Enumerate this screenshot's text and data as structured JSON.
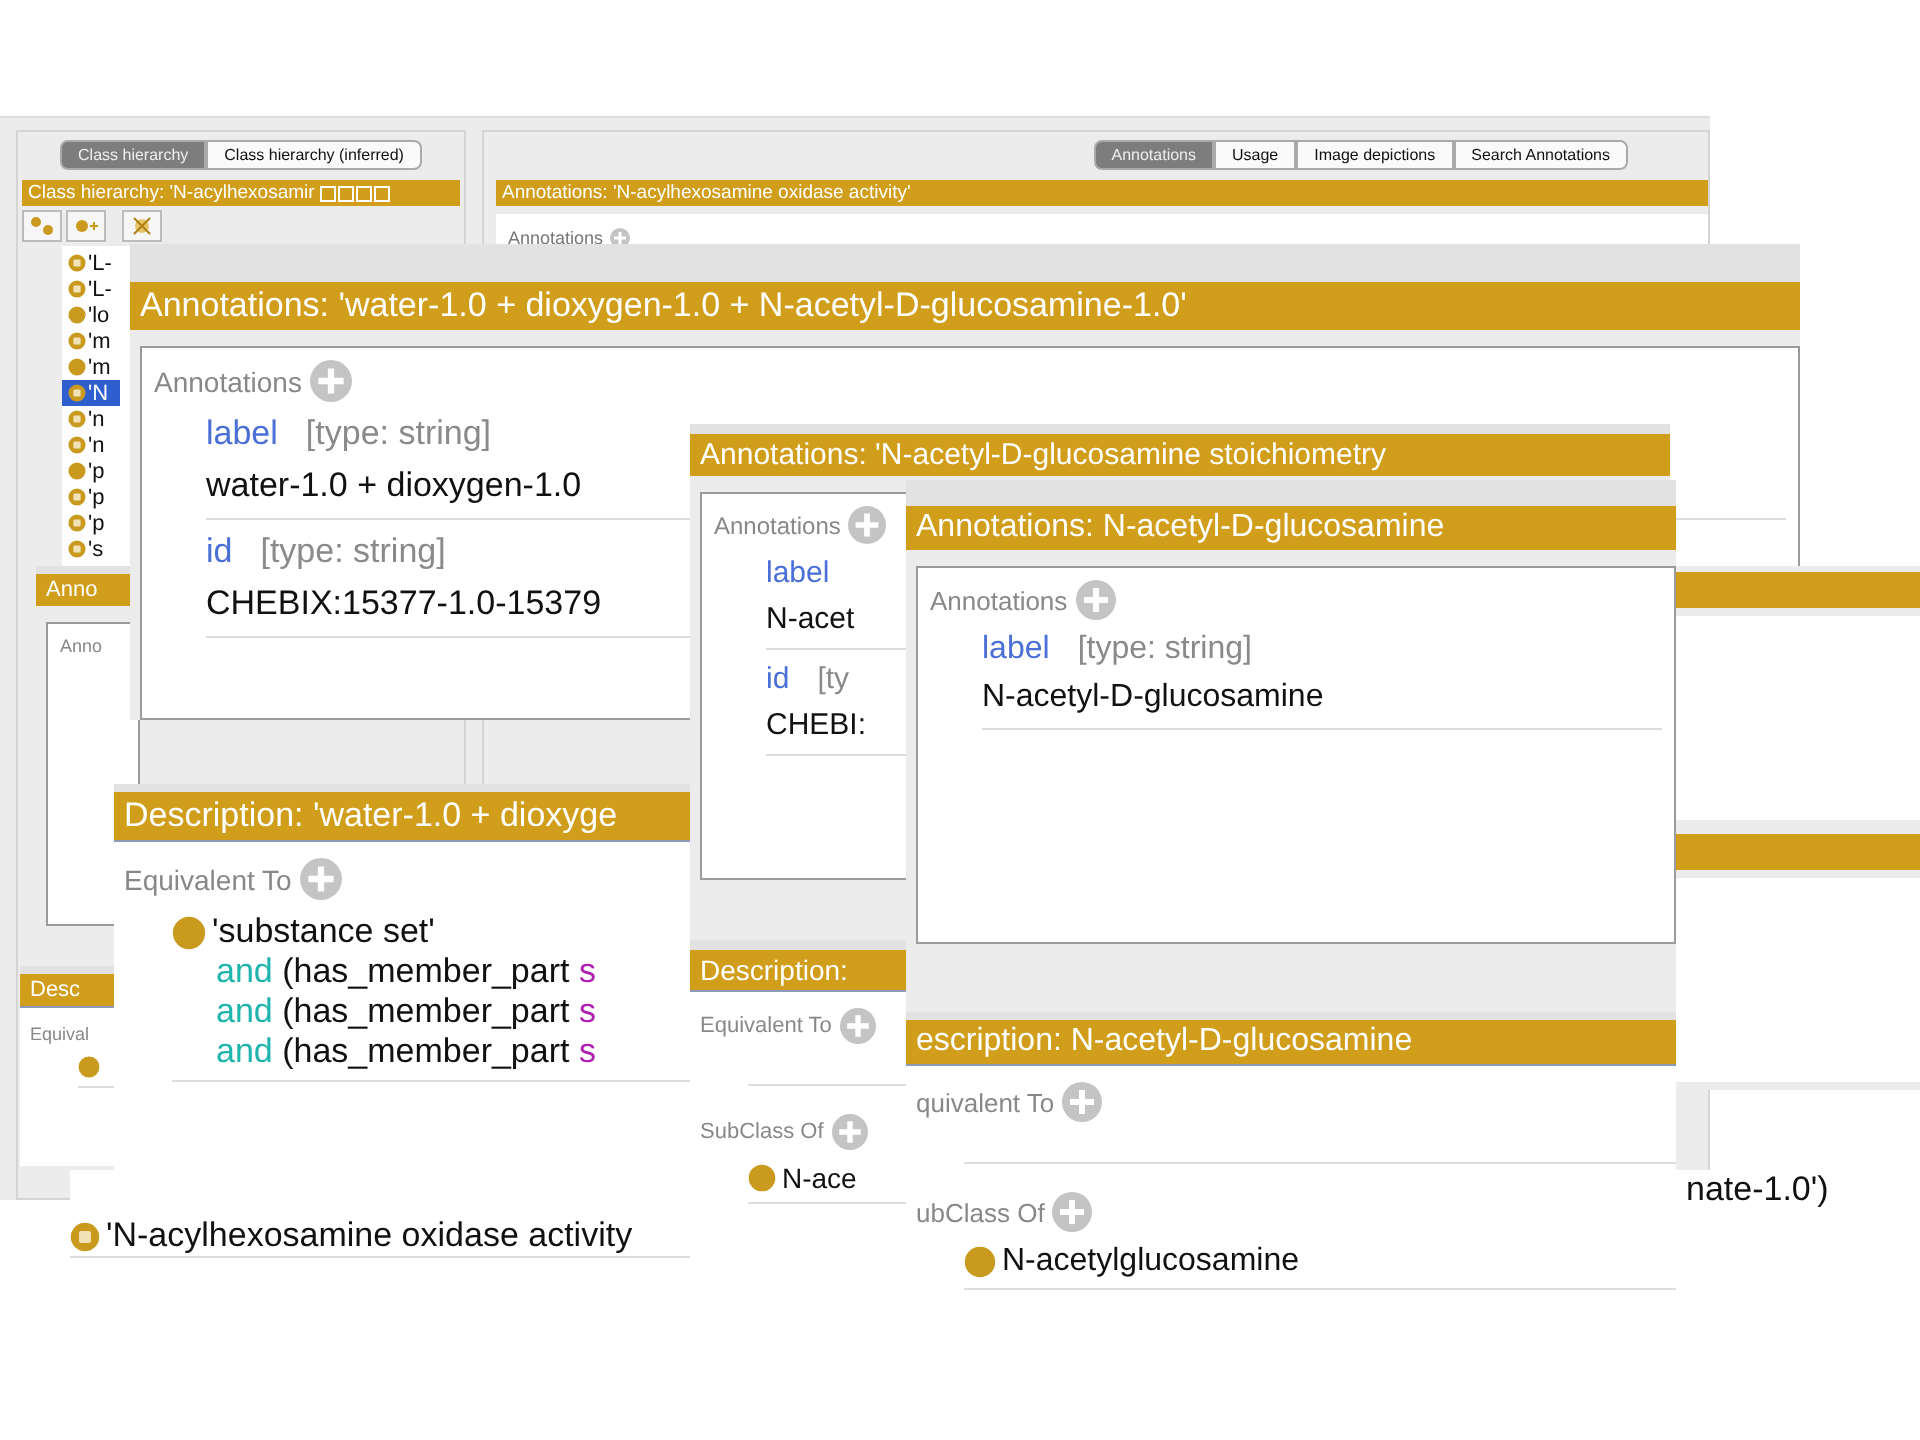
{
  "main_window": {
    "class_tabs": [
      {
        "label": "Class hierarchy",
        "selected": true
      },
      {
        "label": "Class hierarchy (inferred)",
        "selected": false
      }
    ],
    "class_hierarchy_title": "Class hierarchy: 'N-acylhexosamir",
    "tree": [
      {
        "label": "'L-",
        "defined": true,
        "selected": false
      },
      {
        "label": "'L-",
        "defined": true,
        "selected": false
      },
      {
        "label": "'lo",
        "defined": false,
        "selected": false
      },
      {
        "label": "'m",
        "defined": true,
        "selected": false
      },
      {
        "label": "'m",
        "defined": false,
        "selected": false
      },
      {
        "label": "'N",
        "defined": true,
        "selected": true
      },
      {
        "label": "'n",
        "defined": true,
        "selected": false
      },
      {
        "label": "'n",
        "defined": true,
        "selected": false
      },
      {
        "label": "'p",
        "defined": false,
        "selected": false
      },
      {
        "label": "'p",
        "defined": true,
        "selected": false
      },
      {
        "label": "'p",
        "defined": true,
        "selected": false
      },
      {
        "label": "'s",
        "defined": true,
        "selected": false
      }
    ],
    "annotation_tabs": [
      {
        "label": "Annotations",
        "selected": true
      },
      {
        "label": "Usage",
        "selected": false
      },
      {
        "label": "Image depictions",
        "selected": false
      },
      {
        "label": "Search Annotations",
        "selected": false
      }
    ],
    "annotations_title": "Annotations: 'N-acylhexosamine oxidase activity'",
    "annotations_label": "Annotations"
  },
  "panels": [
    {
      "kind": "strip",
      "row": "'N-acylhexosamine oxidase activity",
      "trailing": "nate-1.0')"
    },
    {
      "kind": "annotations",
      "title": "Anno",
      "section": "Anno"
    },
    {
      "kind": "description",
      "title": "Desc",
      "sections": [
        {
          "label": "Equival",
          "items": [
            {
              "kind": "class"
            }
          ]
        }
      ]
    },
    {
      "kind": "annotations",
      "title": "Annotations: 'water-1.0 + dioxygen-1.0 + N-acetyl-D-glucosamine-1.0'",
      "section": "Annotations",
      "entries": [
        {
          "property": "label",
          "type": "[type: string]",
          "value": "water-1.0 + dioxygen-1.0"
        },
        {
          "property": "id",
          "type": "[type: string]",
          "value": "CHEBIX:15377-1.0-15379"
        }
      ]
    },
    {
      "kind": "description",
      "title": "Description: 'water-1.0 + dioxyge",
      "sections": [
        {
          "label": "Equivalent To",
          "items": [
            {
              "kind": "class",
              "text": "'substance set'"
            },
            {
              "kind": "expression",
              "keyword": "and",
              "text": "(has_member_part",
              "tail": "s"
            },
            {
              "kind": "expression",
              "keyword": "and",
              "text": "(has_member_part",
              "tail": "s"
            },
            {
              "kind": "expression",
              "keyword": "and",
              "text": "(has_member_part",
              "tail": "s"
            }
          ]
        }
      ]
    },
    {
      "kind": "annotations",
      "title": "Annotations: 'N-acetyl-D-glucosamine stoichiometry",
      "section": "Annotations",
      "entries": [
        {
          "property": "label",
          "value": "N-acet"
        },
        {
          "property": "id",
          "type": "[ty",
          "value": "CHEBI:"
        }
      ]
    },
    {
      "kind": "description",
      "title": "Description:",
      "sections": [
        {
          "label": "Equivalent To"
        },
        {
          "label": "SubClass Of",
          "items": [
            {
              "kind": "class",
              "text": "N-ace"
            }
          ]
        }
      ]
    },
    {
      "kind": "annotations",
      "title": "Annotations: N-acetyl-D-glucosamine",
      "section": "Annotations",
      "entries": [
        {
          "property": "label",
          "type": "[type: string]",
          "value": "N-acetyl-D-glucosamine"
        }
      ]
    },
    {
      "kind": "description",
      "title": "escription: N-acetyl-D-glucosamine",
      "sections": [
        {
          "label": "quivalent To"
        },
        {
          "label": "ubClass Of",
          "items": [
            {
              "kind": "class",
              "text": "N-acetylglucosamine"
            }
          ]
        }
      ]
    },
    {
      "kind": "fragment"
    }
  ]
}
